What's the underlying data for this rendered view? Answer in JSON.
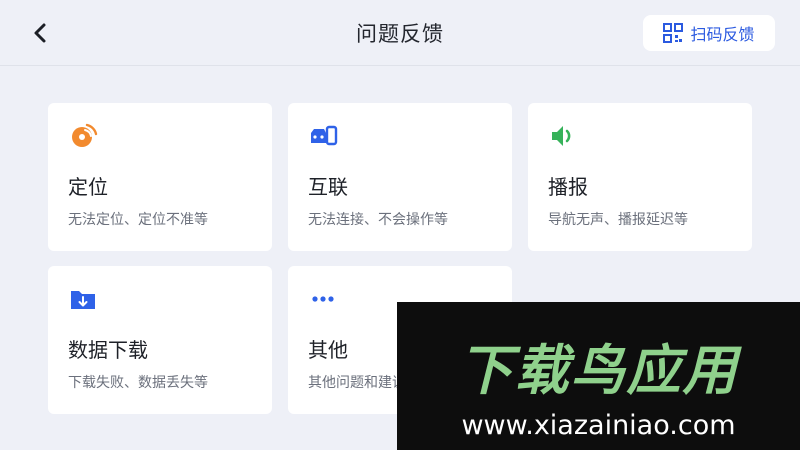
{
  "header": {
    "title": "问题反馈",
    "back_icon": "chevron-left-icon",
    "scan_button": {
      "label": "扫码反馈",
      "icon": "qr-code-icon"
    }
  },
  "cards": [
    {
      "title": "定位",
      "desc": "无法定位、定位不准等",
      "icon": "location-signal-icon",
      "color": "#f28a2e"
    },
    {
      "title": "互联",
      "desc": "无法连接、不会操作等",
      "icon": "car-phone-link-icon",
      "color": "#2f62e8"
    },
    {
      "title": "播报",
      "desc": "导航无声、播报延迟等",
      "icon": "speaker-icon",
      "color": "#36b25a"
    },
    {
      "title": "数据下载",
      "desc": "下载失败、数据丢失等",
      "icon": "folder-download-icon",
      "color": "#2f62e8"
    },
    {
      "title": "其他",
      "desc": "其他问题和建议",
      "icon": "more-dots-icon",
      "color": "#2f62e8"
    }
  ],
  "watermark": {
    "title": "下载鸟应用",
    "url": "www.xiazainiao.com"
  },
  "colors": {
    "background": "#eef0f7",
    "accent": "#2b5ae0",
    "watermark_green": "#8fd18c"
  }
}
